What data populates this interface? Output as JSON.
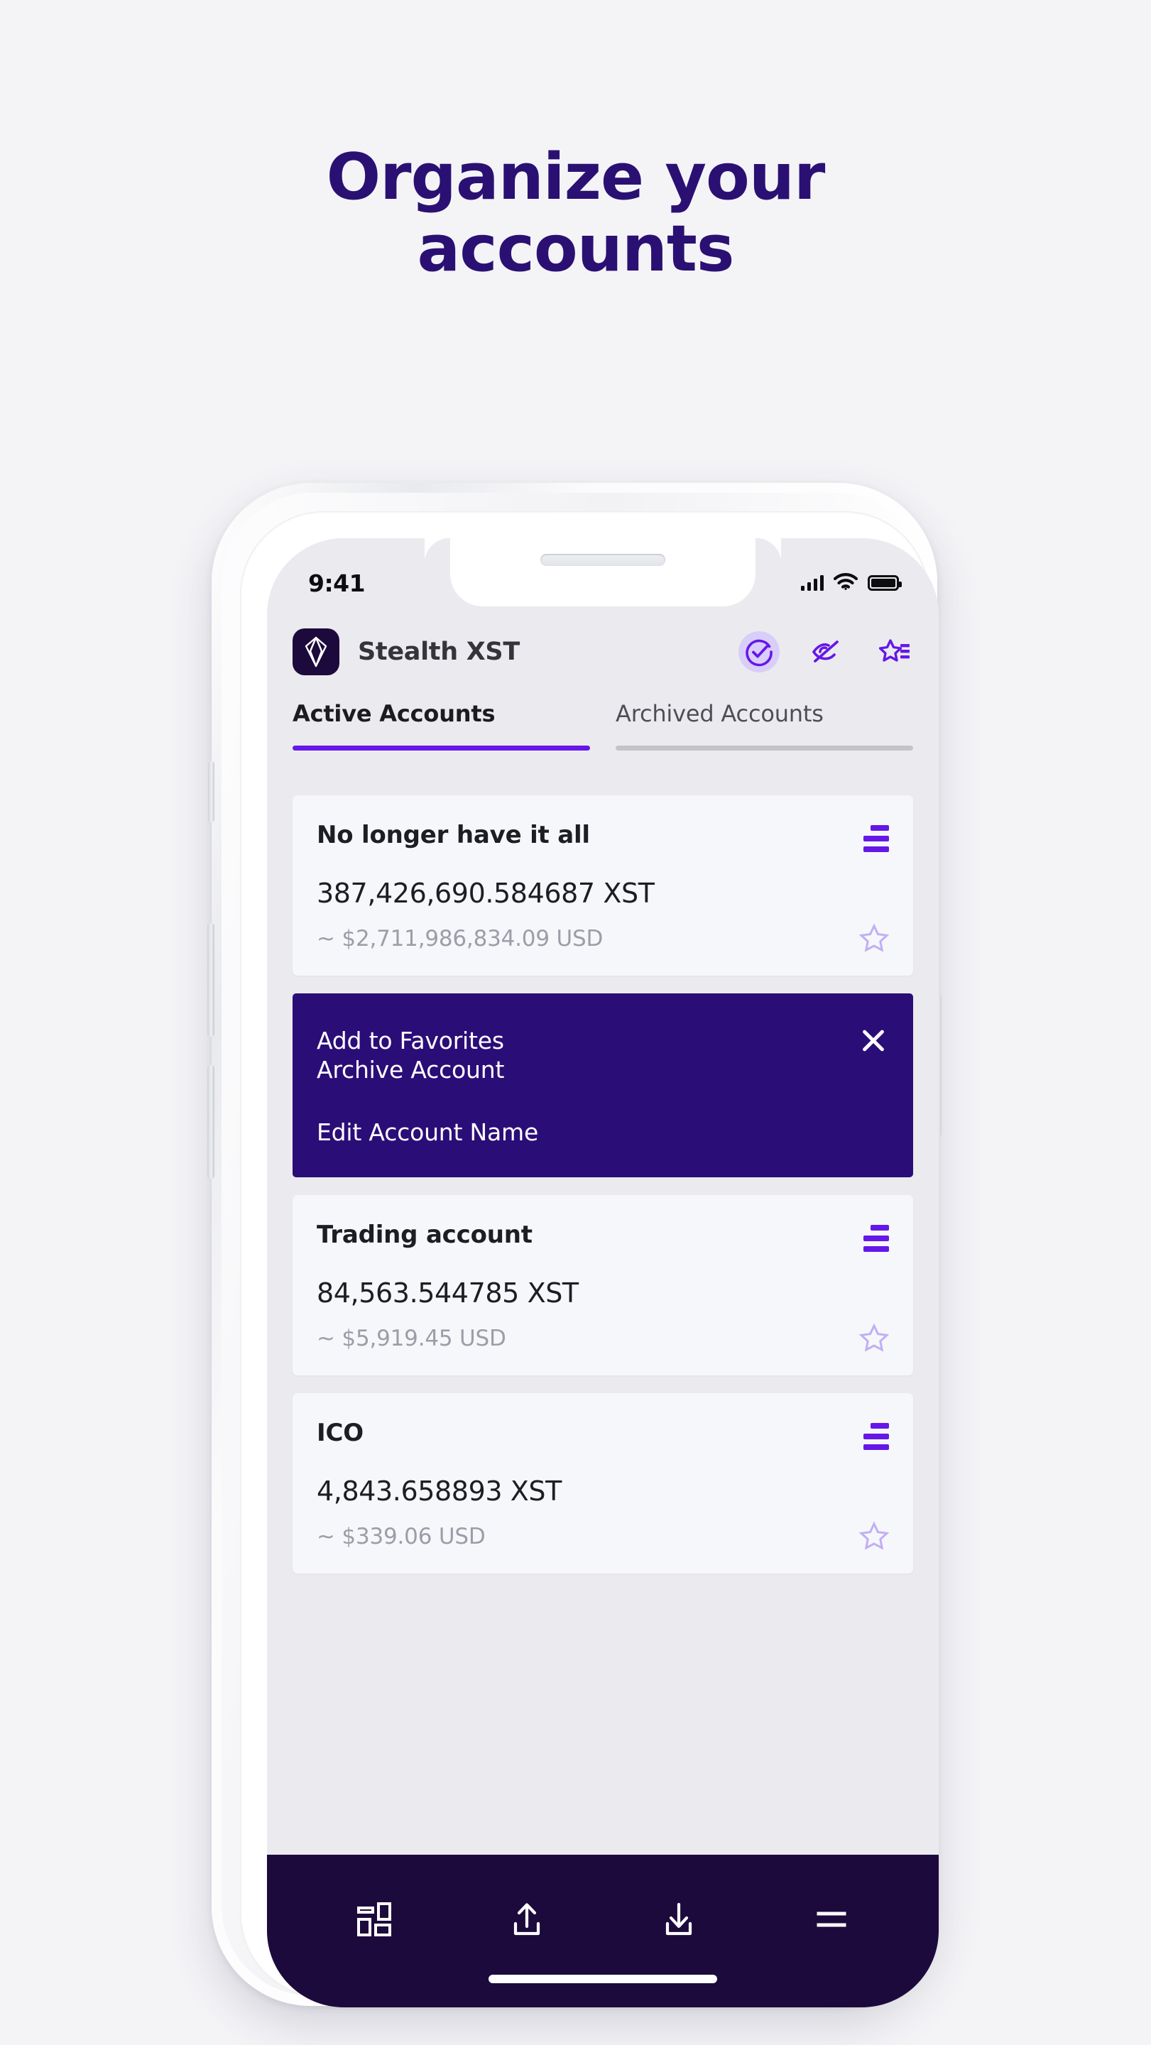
{
  "headline": {
    "line1": "Organize your",
    "line2": "accounts",
    "color": "#2b1073"
  },
  "theme": {
    "accent_purple": "#6517e8",
    "deep_navy": "#1d0a3c",
    "panel_purple": "#2b0d78",
    "page_bg": "#f4f4f7",
    "app_bg": "#ebebef",
    "card_bg": "#f6f7fa",
    "muted_text": "#9d9da8"
  },
  "status_bar": {
    "time": "9:41",
    "icons": [
      "signal-bars-icon",
      "wifi-icon",
      "battery-icon"
    ]
  },
  "app_header": {
    "logo_name": "stealth-xst-logo",
    "title": "Stealth XST",
    "actions": [
      {
        "name": "verify-check-icon",
        "icon": "check-circle-icon",
        "active": true
      },
      {
        "name": "hide-balance-icon",
        "icon": "eye-off-icon",
        "active": false
      },
      {
        "name": "favorites-list-icon",
        "icon": "star-list-icon",
        "active": false
      }
    ]
  },
  "tabs": [
    {
      "label": "Active Accounts",
      "active": true
    },
    {
      "label": "Archived Accounts",
      "active": false
    }
  ],
  "accounts": [
    {
      "name": "No longer have it all",
      "amount": "387,426,690.584687 XST",
      "usd": "~ $2,711,986,834.09 USD",
      "menu_icon": "list-menu-icon",
      "favorite_icon": "star-outline-icon"
    },
    {
      "name": "Trading account",
      "amount": "84,563.544785 XST",
      "usd": "~ $5,919.45 USD",
      "menu_icon": "list-menu-icon",
      "favorite_icon": "star-outline-icon"
    },
    {
      "name": "ICO",
      "amount": "4,843.658893 XST",
      "usd": "~ $339.06 USD",
      "menu_icon": "list-menu-icon",
      "favorite_icon": "star-outline-icon"
    }
  ],
  "action_panel": {
    "items": [
      "Add to Favorites",
      "Archive Account",
      "Edit Account Name"
    ],
    "close_icon": "close-icon"
  },
  "bottom_nav": [
    {
      "name": "dashboard-grid-icon",
      "label": "dashboard"
    },
    {
      "name": "send-upload-icon",
      "label": "send"
    },
    {
      "name": "receive-download-icon",
      "label": "receive"
    },
    {
      "name": "hamburger-menu-icon",
      "label": "menu"
    }
  ]
}
